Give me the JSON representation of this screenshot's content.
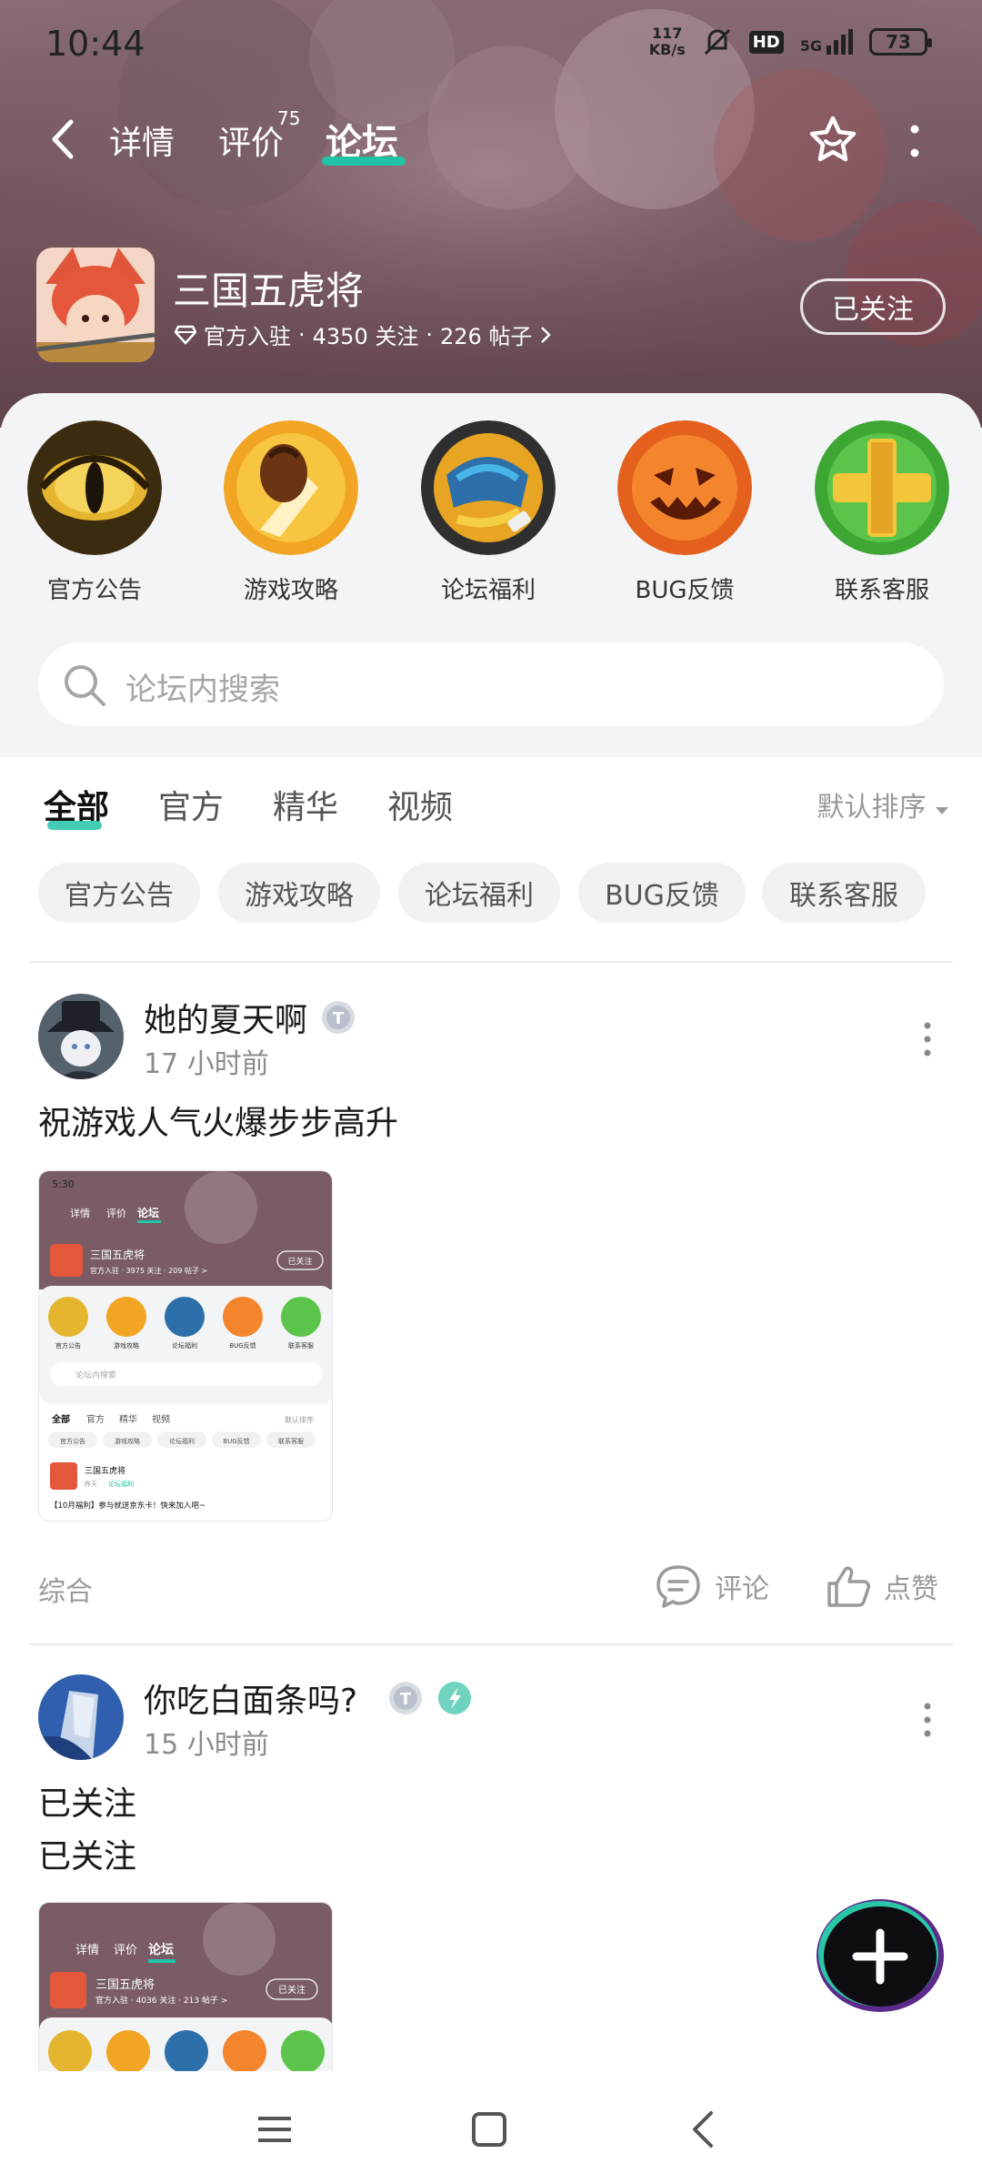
{
  "status_bar": {
    "time": "10:44",
    "net_speed_value": "117",
    "net_speed_unit": "KB/s",
    "hd": "HD",
    "network": "5G",
    "battery": "73"
  },
  "nav": {
    "tabs": [
      {
        "label": "详情"
      },
      {
        "label": "评价",
        "badge": "75"
      },
      {
        "label": "论坛"
      }
    ],
    "active_tab": "论坛"
  },
  "game": {
    "name": "三国五虎将",
    "official": "官方入驻",
    "followers": "4350 关注",
    "posts": "226 帖子",
    "sep": "·",
    "follow_label": "已关注"
  },
  "categories": [
    {
      "label": "官方公告",
      "icon": "eye-icon"
    },
    {
      "label": "游戏攻略",
      "icon": "fist-icon"
    },
    {
      "label": "论坛福利",
      "icon": "gift-fist-icon"
    },
    {
      "label": "BUG反馈",
      "icon": "pumpkin-icon"
    },
    {
      "label": "联系客服",
      "icon": "plus-icon"
    }
  ],
  "search": {
    "placeholder": "论坛内搜索"
  },
  "filter_tabs": [
    {
      "label": "全部"
    },
    {
      "label": "官方"
    },
    {
      "label": "精华"
    },
    {
      "label": "视频"
    }
  ],
  "sort_label": "默认排序",
  "chips": [
    "官方公告",
    "游戏攻略",
    "论坛福利",
    "BUG反馈",
    "联系客服"
  ],
  "posts": [
    {
      "author": "她的夏天啊",
      "time": "17 小时前",
      "lines": [
        "祝游戏人气火爆步步高升"
      ],
      "tag": "综合",
      "comment_label": "评论",
      "like_label": "点赞",
      "thumb": {
        "time": "5:30",
        "tabs": [
          "详情",
          "评价",
          "论坛"
        ],
        "name": "三国五虎将",
        "meta": "官方入驻 · 3975 关注 · 209 帖子 >",
        "follow": "已关注",
        "cats": [
          "官方公告",
          "游戏攻略",
          "论坛福利",
          "BUG反馈",
          "联系客服"
        ],
        "search": "论坛内搜索",
        "ftabs": [
          "全部",
          "官方",
          "精华",
          "视频"
        ],
        "sort": "默认排序",
        "chips": [
          "官方公告",
          "游戏攻略",
          "论坛福利",
          "BUG反馈",
          "联系客服"
        ],
        "post_author": "三国五虎将",
        "post_time": "昨天",
        "post_tag": "论坛福利",
        "post_title": "【10月福利】参与就送京东卡！快来加入吧~"
      }
    },
    {
      "author": "你吃白面条吗?",
      "time": "15 小时前",
      "lines": [
        "已关注",
        "已关注"
      ],
      "thumb": {
        "tabs": [
          "详情",
          "评价",
          "论坛"
        ],
        "name": "三国五虎将",
        "meta": "官方入驻 · 4036 关注 · 213 帖子 >",
        "follow": "已关注"
      }
    }
  ],
  "colors": {
    "accent": "#20c3a6",
    "hero": "#7a5c66",
    "panel": "#f3f4f6",
    "muted": "#9a9a9a"
  }
}
